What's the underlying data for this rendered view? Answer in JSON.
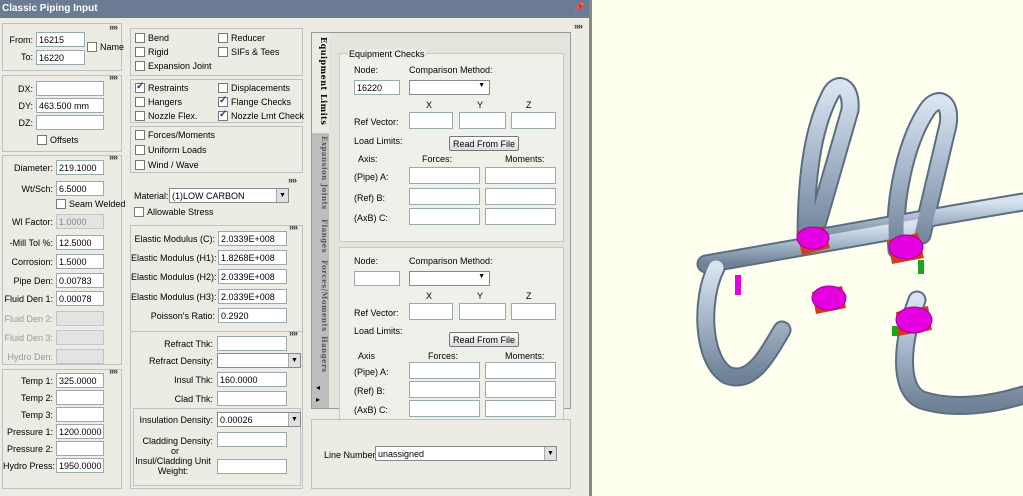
{
  "window": {
    "title": "Classic Piping Input",
    "pin": "📌"
  },
  "expander": "»»",
  "nodes": {
    "from_label": "From:",
    "from_value": "16215",
    "to_label": "To:",
    "to_value": "16220",
    "name_label": "Name"
  },
  "deltas": {
    "dx_label": "DX:",
    "dx_value": "",
    "dy_label": "DY:",
    "dy_value": "463.500 mm",
    "dz_label": "DZ:",
    "dz_value": "",
    "offsets_label": "Offsets"
  },
  "pipe": {
    "diameter_label": "Diameter:",
    "diameter_value": "219.1000",
    "wtsch_label": "Wt/Sch:",
    "wtsch_value": "6.5000",
    "seam_label": "Seam Welded",
    "wlfactor_label": "Wl Factor:",
    "wlfactor_value": "1.0000",
    "milltol_label": "-Mill Tol %:",
    "milltol_value": "12.5000",
    "corrosion_label": "Corrosion:",
    "corrosion_value": "1.5000",
    "pipeden_label": "Pipe Den:",
    "pipeden_value": "0.00783",
    "fluidden1_label": "Fluid Den 1:",
    "fluidden1_value": "0.00078",
    "fluidden2_label": "Fluid Den 2:",
    "fluidden3_label": "Fluid Den 3:",
    "hydroden_label": "Hydro Den:"
  },
  "temps": {
    "temp1_label": "Temp 1:",
    "temp1_value": "325.0000",
    "temp2_label": "Temp 2:",
    "temp3_label": "Temp 3:",
    "press1_label": "Pressure 1:",
    "press1_value": "1200.0000",
    "press2_label": "Pressure 2:",
    "hydro_label": "Hydro Press:",
    "hydro_value": "1950.0000"
  },
  "elements": {
    "bend": "Bend",
    "reducer": "Reducer",
    "rigid": "Rigid",
    "sifs": "SIFs & Tees",
    "expansion": "Expansion Joint"
  },
  "boundary": {
    "restraints": "Restraints",
    "displacements": "Displacements",
    "hangers": "Hangers",
    "flange": "Flange Checks",
    "nozzleflex": "Nozzle Flex.",
    "nozzlelmt": "Nozzle Lmt Check"
  },
  "loads": {
    "forces": "Forces/Moments",
    "uniform": "Uniform Loads",
    "wind": "Wind / Wave"
  },
  "material": {
    "label": "Material:",
    "value": "(1)LOW CARBON",
    "allowable": "Allowable Stress"
  },
  "elastic": {
    "ec_label": "Elastic Modulus (C):",
    "ec_value": "2.0339E+008",
    "eh1_label": "Elastic Modulus (H1):",
    "eh1_value": "1.8268E+008",
    "eh2_label": "Elastic Modulus (H2):",
    "eh2_value": "2.0339E+008",
    "eh3_label": "Elastic Modulus (H3):",
    "eh3_value": "2.0339E+008",
    "poisson_label": "Poisson's Ratio:",
    "poisson_value": "0.2920"
  },
  "insulation": {
    "refthk_label": "Refract Thk:",
    "refden_label": "Refract Density:",
    "insthk_label": "Insul Thk:",
    "insthk_value": "160.0000",
    "cladthk_label": "Clad Thk:",
    "insden_label": "Insulation Density:",
    "insden_value": "0.00026",
    "cladden_label": "Cladding Density:",
    "or_label": "or",
    "unitwt_label": "Insul/Cladding Unit Weight:"
  },
  "equipment": {
    "group_title": "Equipment Checks",
    "node_label": "Node:",
    "node1_value": "16220",
    "node2_value": "",
    "method_label": "Comparison Method:",
    "x": "X",
    "y": "Y",
    "z": "Z",
    "refvector": "Ref Vector:",
    "loadlimits": "Load Limits:",
    "readfile": "Read From File",
    "axis1": "Axis:",
    "axis2": "Axis",
    "forces1": "Forces:",
    "forces2": "Forces:",
    "moments": "Moments:",
    "pipe_a": "(Pipe) A:",
    "ref_b": "(Ref) B:",
    "axb_c": "(AxB) C:"
  },
  "tabs": [
    "Equipment Limits",
    "Expansion Joints",
    "Flanges",
    "Forces/Moments",
    "Hangers"
  ],
  "tab_arrows": {
    "left": "◂",
    "right": "▸"
  },
  "linenumber": {
    "label": "Line Number :",
    "value": "unassigned"
  },
  "colors": {
    "pipe": "#a7b8cc",
    "restraint": "#e400e0",
    "anchor": "#d63a1a",
    "node_marker": "#1ca51c",
    "background": "#fffff0"
  }
}
